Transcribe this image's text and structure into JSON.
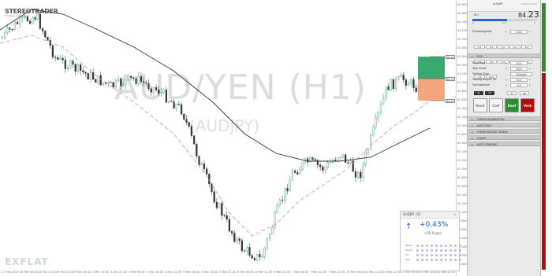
{
  "chart": {
    "instrument_title": "AUD/YEN (H1)",
    "symbol": "(AUDJPY)",
    "logo_name": "STEREOTRADER",
    "logo_sub": "Windows made easy",
    "flat_logo": "EXFLAT",
    "price_labels": [
      "84.800",
      "84.600",
      "84.400",
      "84.200",
      "84.000",
      "83.800",
      "83.600",
      "83.400",
      "83.200",
      "83.000",
      "82.800",
      "82.600",
      "82.400",
      "82.200",
      "82.000",
      "81.800",
      "81.600",
      "81.400",
      "81.200",
      "81.000",
      "80.800",
      "80.600",
      "80.400",
      "80.200",
      "80.000",
      "79.800",
      "79.600",
      "79.400",
      "79.200",
      "79.000",
      "78.800"
    ],
    "time_labels": [
      "27 Feb 2025",
      "28 Feb 06:00",
      "28 Feb 14:00",
      "28 Feb 22:00",
      "3 Mar 06:00",
      "3 Mar 14:00",
      "3 Mar 22:00",
      "4 Mar 06:00",
      "4 Mar 14:00",
      "4 Mar 22:00",
      "5 Mar 06:00",
      "5 Mar 14:00",
      "5 Mar 22:00",
      "6 Mar 06:00",
      "6 Mar 14:00",
      "6 Mar 22:00",
      "7 Mar 06:00",
      "7 Mar 14:00",
      "7 Mar 22:00",
      "10 Mar 06:00",
      "10 Mar 14:00",
      "10 Mar 22:00",
      "11 Mar 06:00",
      "11 Mar 14:00",
      "11 Mar 22:00"
    ],
    "tp_tag": "84.16",
    "entry_tag": "83.72",
    "sl_tag": "83.42",
    "colors": {
      "bull": "#2e9a57",
      "bear": "#333333",
      "ma_slow": "#333333",
      "ma_fast": "#d49aa6",
      "tp_zone": "#3aa870",
      "sl_zone": "#f4a57d"
    }
  },
  "widget": {
    "title": "AUDJPY, D1",
    "close": "×",
    "arrow": "↑",
    "change": "+0.43%",
    "pips": "+35.9 pips",
    "row_labels": [
      "Week",
      "Month",
      "Qtr",
      "Year"
    ],
    "col_labels": [
      "1",
      "2",
      "3",
      "4",
      "5",
      "6",
      "7",
      "8",
      "9",
      "10"
    ]
  },
  "panel": {
    "title": "AUDJPY",
    "mode": "Default Order",
    "price_label": "Bid",
    "price_small": "84.",
    "price_big": "23",
    "spread_left": "0",
    "spread_mid": "1.6",
    "spread_right": "3",
    "positionsize_label": "Positionsgröße",
    "positionsize_value": "0.44",
    "lot_buttons": [
      "0.1",
      "0.5",
      "1.0",
      "2.0",
      "1.5",
      "2.5",
      "3.0",
      "4.0",
      "5.0",
      "6.0",
      "7.5",
      "10.0"
    ],
    "pos_section": "POS",
    "stop_loss_label": "Stop Loss",
    "stop_loss_value": "10.0",
    "take_profit_label": "Take Profit",
    "take_profit_value": "20.0",
    "trailing_stop_label": "Trailing-Stop",
    "trailing_stop_value": "Straight",
    "trailing_begin_label": "Trailing Beginn SE",
    "trailing_begin_value": "10.0",
    "trail_abstand_label": "Trail-Abstand",
    "trail_abstand_value": "5.0",
    "sl_button": "SL",
    "tp_button": "TP",
    "tl_button": "TL",
    "se_button": "SE",
    "reset_button": "Reset",
    "conf_button": "Conf",
    "buy_button": "Kauf",
    "sell_button": "Verk",
    "sections": [
      "ORDER BEARBEITEN",
      "AUTO EXIT",
      "STRATEGISCHE ORDER",
      "CHART",
      "AUTO-TRADING"
    ]
  }
}
